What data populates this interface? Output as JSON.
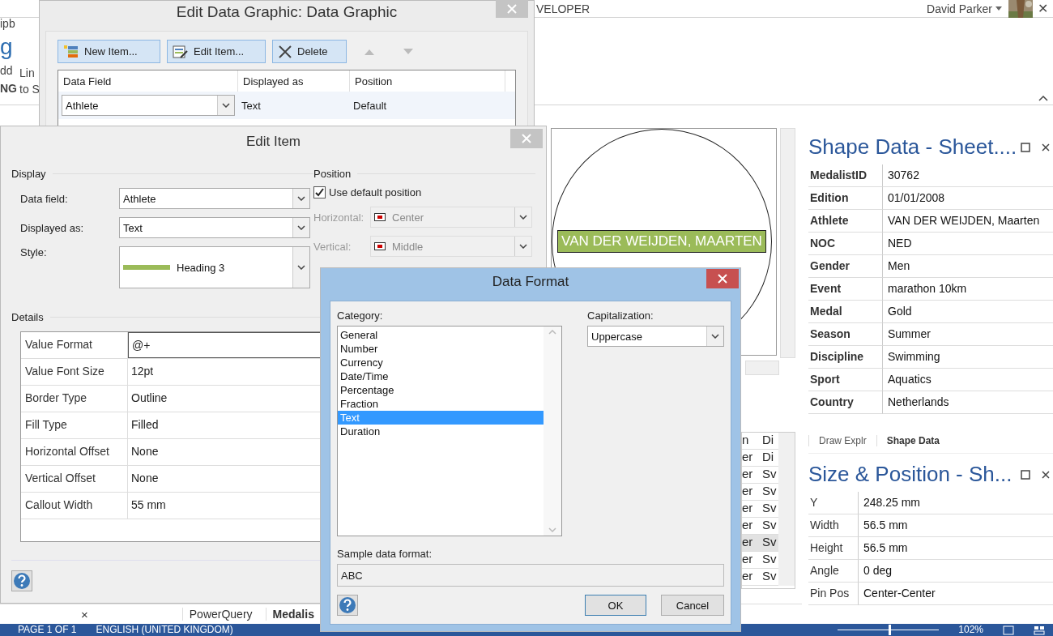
{
  "app": {
    "ribbon_tab": "VELOPER",
    "user": "David Parker",
    "close": "✕",
    "left_fragments": [
      {
        "kind": "small",
        "text": "ipb"
      },
      {
        "kind": "big",
        "text": "g"
      },
      {
        "kind": "small",
        "text": "dd"
      },
      {
        "kind": "bold",
        "text": "NG"
      }
    ],
    "ribbon_fragments": [
      "Lin",
      "to S"
    ]
  },
  "canvas": {
    "label": "VAN DER WEIJDEN, MAARTEN"
  },
  "back_table": {
    "columns": [
      "n",
      "Di"
    ],
    "rows": [
      {
        "cells": [
          "er",
          "Di"
        ],
        "selected": false
      },
      {
        "cells": [
          "er",
          "Sv"
        ],
        "selected": false
      },
      {
        "cells": [
          "er",
          "Sv"
        ],
        "selected": false
      },
      {
        "cells": [
          "er",
          "Sv"
        ],
        "selected": false
      },
      {
        "cells": [
          "er",
          "Sv"
        ],
        "selected": false
      },
      {
        "cells": [
          "er",
          "Sv"
        ],
        "selected": true
      },
      {
        "cells": [
          "er",
          "Sv"
        ],
        "selected": false
      },
      {
        "cells": [
          "er",
          "Sv"
        ],
        "selected": false
      }
    ]
  },
  "shape_data": {
    "title": "Shape Data - Sheet....",
    "rows": [
      {
        "label": "MedalistID",
        "value": "30762"
      },
      {
        "label": "Edition",
        "value": "01/01/2008"
      },
      {
        "label": "Athlete",
        "value": "VAN DER WEIJDEN, Maarten"
      },
      {
        "label": "NOC",
        "value": "NED"
      },
      {
        "label": "Gender",
        "value": "Men"
      },
      {
        "label": "Event",
        "value": "marathon 10km"
      },
      {
        "label": "Medal",
        "value": "Gold"
      },
      {
        "label": "Season",
        "value": "Summer"
      },
      {
        "label": "Discipline",
        "value": "Swimming"
      },
      {
        "label": "Sport",
        "value": "Aquatics"
      },
      {
        "label": "Country",
        "value": "Netherlands"
      }
    ]
  },
  "panel_tabs": [
    {
      "label": "Draw Explr",
      "selected": false
    },
    {
      "label": "Shape Data",
      "selected": true
    }
  ],
  "size_position": {
    "title": "Size & Position - Sh...",
    "rows": [
      {
        "label": "Y",
        "value": "248.25 mm"
      },
      {
        "label": "Width",
        "value": "56.5 mm"
      },
      {
        "label": "Height",
        "value": "56.5 mm"
      },
      {
        "label": "Angle",
        "value": "0 deg"
      },
      {
        "label": "Pin Pos",
        "value": "Center-Center"
      }
    ]
  },
  "sheet_tabs": {
    "close": "×",
    "tabs": [
      {
        "label": "PowerQuery",
        "selected": false
      },
      {
        "label": "Medalis",
        "selected": true
      }
    ]
  },
  "status_bar": {
    "page": "PAGE 1 OF 1",
    "language": "ENGLISH (UNITED KINGDOM)",
    "zoom": "102%",
    "zoom_slider": {
      "level": 0.5
    }
  },
  "edit_data_graphic": {
    "title": "Edit Data Graphic: Data Graphic",
    "buttons": [
      {
        "kind": "new",
        "label": "New Item..."
      },
      {
        "kind": "edit",
        "label": "Edit Item..."
      },
      {
        "kind": "delete",
        "label": "Delete"
      }
    ],
    "columns": [
      "Data Field",
      "Displayed as",
      "Position"
    ],
    "rows": [
      {
        "data_field": "Athlete",
        "displayed_as": "Text",
        "position": "Default",
        "selected": true
      }
    ]
  },
  "edit_item": {
    "title": "Edit Item",
    "display_heading": "Display",
    "fields": [
      {
        "label": "Data field:",
        "value": "Athlete"
      },
      {
        "label": "Displayed as:",
        "value": "Text"
      }
    ],
    "style": {
      "label": "Style:",
      "value": "Heading 3"
    },
    "position_heading": "Position",
    "use_default": {
      "label": "Use default position",
      "checked": true
    },
    "position_fields": [
      {
        "label": "Horizontal:",
        "value": "Center",
        "disabled": true
      },
      {
        "label": "Vertical:",
        "value": "Middle",
        "disabled": true
      }
    ],
    "details_heading": "Details",
    "details": [
      {
        "label": "Value Format",
        "value": "@+",
        "focused": true
      },
      {
        "label": "Value Font Size",
        "value": "12pt",
        "focused": false
      },
      {
        "label": "Border Type",
        "value": "Outline",
        "focused": false
      },
      {
        "label": "Fill Type",
        "value": "Filled",
        "focused": false
      },
      {
        "label": "Horizontal Offset",
        "value": "None",
        "focused": false
      },
      {
        "label": "Vertical Offset",
        "value": "None",
        "focused": false
      },
      {
        "label": "Callout Width",
        "value": "55 mm",
        "focused": false
      }
    ]
  },
  "data_format": {
    "title": "Data Format",
    "category_label": "Category:",
    "categories": [
      {
        "label": "General",
        "selected": false
      },
      {
        "label": "Number",
        "selected": false
      },
      {
        "label": "Currency",
        "selected": false
      },
      {
        "label": "Date/Time",
        "selected": false
      },
      {
        "label": "Percentage",
        "selected": false
      },
      {
        "label": "Fraction",
        "selected": false
      },
      {
        "label": "Text",
        "selected": true
      },
      {
        "label": "Duration",
        "selected": false
      }
    ],
    "capitalization_label": "Capitalization:",
    "capitalization": "Uppercase",
    "sample_label": "Sample data format:",
    "sample": "ABC",
    "buttons": [
      {
        "label": "OK",
        "default": true
      },
      {
        "label": "Cancel",
        "default": false
      }
    ]
  }
}
